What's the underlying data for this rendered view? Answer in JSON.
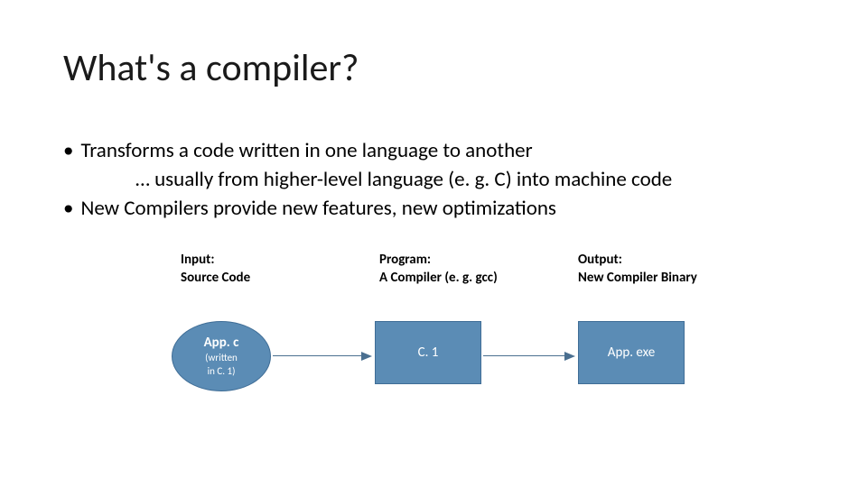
{
  "title": "What's a compiler?",
  "bullets": {
    "b1": "Transforms a code written in one language to another",
    "b1sub": "… usually from higher-level language (e. g. C) into machine code",
    "b2": "New Compilers provide new features, new optimizations"
  },
  "diagram": {
    "labels": {
      "input_l1": "Input:",
      "input_l2": "Source Code",
      "program_l1": "Program:",
      "program_l2": "A Compiler (e. g. gcc)",
      "output_l1": "Output:",
      "output_l2": "New Compiler Binary"
    },
    "nodes": {
      "ellipse_main": "App. c",
      "ellipse_sub1": "(written",
      "ellipse_sub2": "in C. 1)",
      "rect1": "C. 1",
      "rect2": "App. exe"
    }
  },
  "chart_data": {
    "type": "diagram",
    "title": "What's a compiler?",
    "nodes": [
      {
        "id": "app_c",
        "shape": "ellipse",
        "label": "App.c (written in C.1)",
        "role": "Input: Source Code"
      },
      {
        "id": "c1",
        "shape": "rect",
        "label": "C.1",
        "role": "Program: A Compiler (e.g. gcc)"
      },
      {
        "id": "appexe",
        "shape": "rect",
        "label": "App.exe",
        "role": "Output: New Compiler Binary"
      }
    ],
    "edges": [
      {
        "from": "app_c",
        "to": "c1"
      },
      {
        "from": "c1",
        "to": "appexe"
      }
    ]
  }
}
